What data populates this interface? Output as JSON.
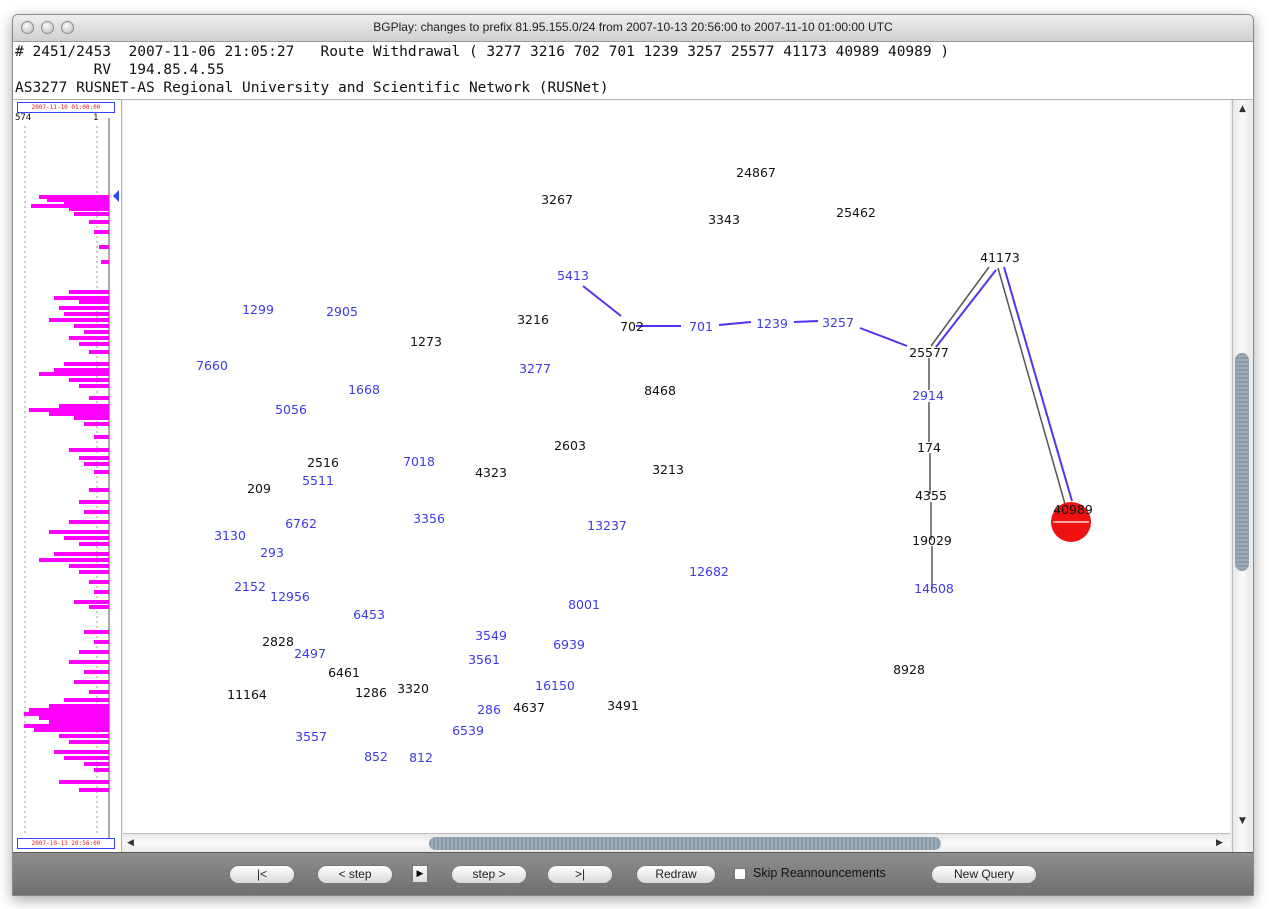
{
  "window": {
    "title": "BGPlay: changes to prefix 81.95.155.0/24 from 2007-10-13 20:56:00 to 2007-11-10 01:00:00 UTC"
  },
  "info": {
    "line1": "# 2451/2453  2007-11-06 21:05:27   Route Withdrawal ( 3277 3216 702 701 1239 3257 25577 41173 40989 40989 )",
    "line2": "         RV  194.85.4.55",
    "line3": "AS3277 RUSNET-AS Regional University and Scientific Network (RUSNet)"
  },
  "timeline": {
    "top_timestamp": "2007-11-10 01:00:00",
    "bottom_timestamp": "2007-10-13 20:56:00",
    "left_tick": "574",
    "right_tick": "1",
    "bar_color": "#ff00ff",
    "marker_color": "#2a4cff"
  },
  "graph": {
    "nodes": [
      {
        "id": "24867",
        "color": "black"
      },
      {
        "id": "3267",
        "color": "black"
      },
      {
        "id": "3343",
        "color": "black"
      },
      {
        "id": "25462",
        "color": "black"
      },
      {
        "id": "41173",
        "color": "black"
      },
      {
        "id": "5413",
        "color": "blue"
      },
      {
        "id": "1299",
        "color": "blue"
      },
      {
        "id": "2905",
        "color": "blue"
      },
      {
        "id": "3216",
        "color": "black"
      },
      {
        "id": "702",
        "color": "black"
      },
      {
        "id": "701",
        "color": "blue"
      },
      {
        "id": "1239",
        "color": "blue"
      },
      {
        "id": "3257",
        "color": "blue"
      },
      {
        "id": "1273",
        "color": "black"
      },
      {
        "id": "25577",
        "color": "black"
      },
      {
        "id": "7660",
        "color": "blue"
      },
      {
        "id": "3277",
        "color": "blue"
      },
      {
        "id": "1668",
        "color": "blue"
      },
      {
        "id": "8468",
        "color": "black"
      },
      {
        "id": "2914",
        "color": "blue"
      },
      {
        "id": "5056",
        "color": "blue"
      },
      {
        "id": "2603",
        "color": "black"
      },
      {
        "id": "174",
        "color": "black"
      },
      {
        "id": "2516",
        "color": "black"
      },
      {
        "id": "7018",
        "color": "blue"
      },
      {
        "id": "4323",
        "color": "black"
      },
      {
        "id": "3213",
        "color": "black"
      },
      {
        "id": "5511",
        "color": "blue"
      },
      {
        "id": "209",
        "color": "black"
      },
      {
        "id": "4355",
        "color": "black"
      },
      {
        "id": "40989",
        "color": "black"
      },
      {
        "id": "3356",
        "color": "blue"
      },
      {
        "id": "6762",
        "color": "blue"
      },
      {
        "id": "13237",
        "color": "blue"
      },
      {
        "id": "3130",
        "color": "blue"
      },
      {
        "id": "19029",
        "color": "black"
      },
      {
        "id": "293",
        "color": "blue"
      },
      {
        "id": "12682",
        "color": "blue"
      },
      {
        "id": "2152",
        "color": "blue"
      },
      {
        "id": "12956",
        "color": "blue"
      },
      {
        "id": "14608",
        "color": "blue"
      },
      {
        "id": "8001",
        "color": "blue"
      },
      {
        "id": "6453",
        "color": "blue"
      },
      {
        "id": "3549",
        "color": "blue"
      },
      {
        "id": "2828",
        "color": "black"
      },
      {
        "id": "6939",
        "color": "blue"
      },
      {
        "id": "2497",
        "color": "blue"
      },
      {
        "id": "3561",
        "color": "blue"
      },
      {
        "id": "6461",
        "color": "black"
      },
      {
        "id": "8928",
        "color": "black"
      },
      {
        "id": "16150",
        "color": "blue"
      },
      {
        "id": "11164",
        "color": "black"
      },
      {
        "id": "1286",
        "color": "black"
      },
      {
        "id": "3320",
        "color": "black"
      },
      {
        "id": "4637",
        "color": "black"
      },
      {
        "id": "3491",
        "color": "black"
      },
      {
        "id": "286",
        "color": "blue"
      },
      {
        "id": "6539",
        "color": "blue"
      },
      {
        "id": "3557",
        "color": "blue"
      },
      {
        "id": "852",
        "color": "blue"
      },
      {
        "id": "812",
        "color": "blue"
      }
    ],
    "edge_colors": {
      "active": "#5533ee",
      "previous": "#555555"
    },
    "origin_color": "#ee1111"
  },
  "toolbar": {
    "first": "|<",
    "step_back": "< step",
    "play_icon": "▶",
    "step_fwd": "step >",
    "last": ">|",
    "redraw": "Redraw",
    "skip_label": "Skip Reannouncements",
    "skip_checked": false,
    "new_query": "New Query"
  }
}
